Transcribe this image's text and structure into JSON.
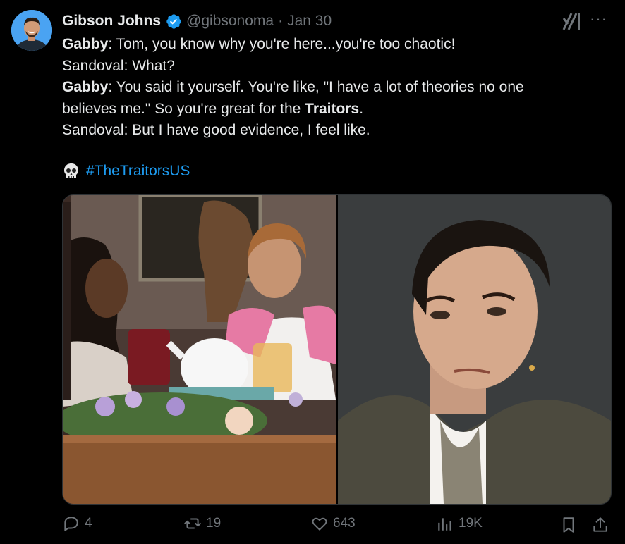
{
  "author": {
    "name": "Gibson Johns",
    "handle": "@gibsonoma",
    "separator": "·",
    "date": "Jan 30",
    "verified_color": "#1d9bf0"
  },
  "tweet": {
    "lines": [
      {
        "speaker": "Gabby",
        "text": ": Tom, you know why you're here...you're too chaotic!"
      },
      {
        "speaker": "",
        "text": "Sandoval: What?"
      },
      {
        "speaker": "Gabby",
        "text": ": You said it yourself. You're like, \"I have a lot of theories no one"
      },
      {
        "speaker": "",
        "text": "believes me.\" So you're great for the ",
        "bold_after": "Traitors",
        "suffix": "."
      },
      {
        "speaker": "",
        "text": "Sandoval: But I have good evidence, I feel like."
      }
    ],
    "emoji": "skull-icon",
    "hashtag": "#TheTraitorsUS",
    "hashtag_color": "#1d9bf0"
  },
  "actions": {
    "replies": "4",
    "reposts": "19",
    "likes": "643",
    "views": "19K"
  },
  "icons": [
    "avatar",
    "verified-badge-icon",
    "grok-icon",
    "more-icon",
    "reply-icon",
    "repost-icon",
    "like-icon",
    "views-icon",
    "bookmark-icon",
    "share-icon"
  ]
}
